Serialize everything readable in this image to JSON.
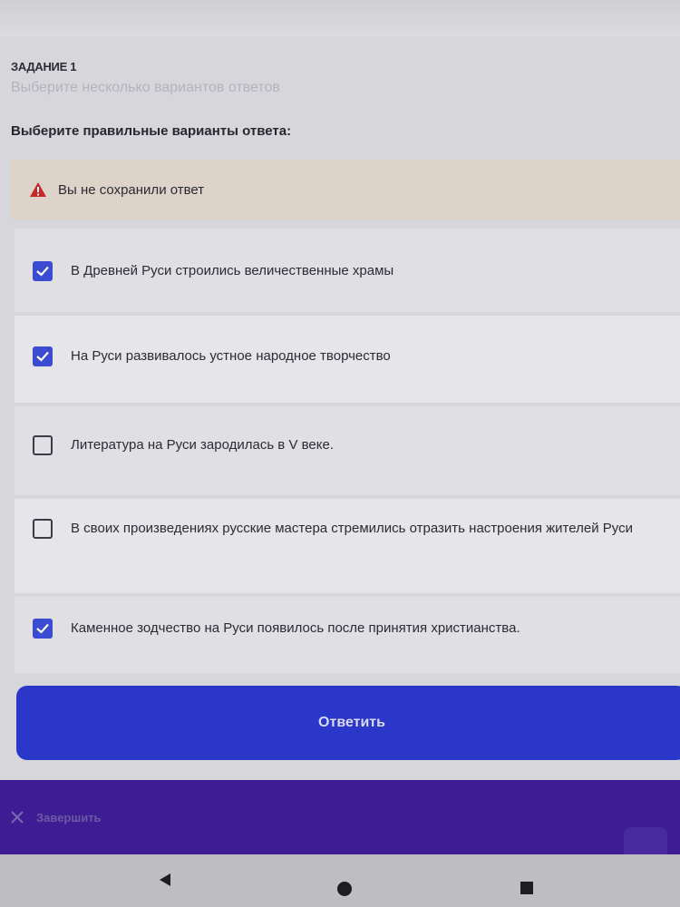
{
  "task": {
    "label": "ЗАДАНИЕ 1",
    "hint": "Выберите несколько вариантов ответов",
    "question": "Выберите правильные варианты ответа:"
  },
  "warning": {
    "text": "Вы не сохранили ответ",
    "icon": "warning-triangle-icon",
    "color": "#c62828"
  },
  "options": [
    {
      "text": "В Древней Руси строились величественные храмы",
      "checked": true
    },
    {
      "text": "На Руси развивалось устное народное творчество",
      "checked": true
    },
    {
      "text": "Литература на Руси зародилась в V веке.",
      "checked": false
    },
    {
      "text": "В своих произведениях русские мастера стремились отразить настроения жителей Руси",
      "checked": false
    },
    {
      "text": "Каменное зодчество на Руси появилось после принятия христианства.",
      "checked": true
    }
  ],
  "submit": {
    "label": "Ответить"
  },
  "footer": {
    "finish_label": "Завершить",
    "close_icon": "close-icon"
  },
  "colors": {
    "accent": "#2a37c8",
    "footer": "#3d1c94",
    "checkbox": "#3b4bd2"
  }
}
